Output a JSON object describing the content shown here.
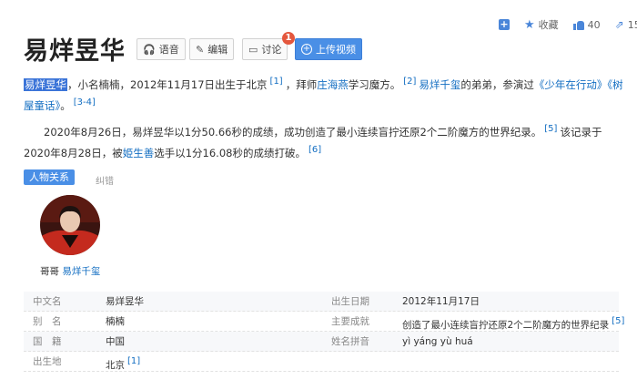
{
  "toolbar": {
    "add_icon": "plus-square-icon",
    "favorite_label": "收藏",
    "like_count": "40",
    "share_count": "15"
  },
  "header": {
    "title": "易烊昱华",
    "buttons": {
      "voice": "语音",
      "edit": "编辑",
      "discuss": "讨论",
      "upload": "上传视频"
    },
    "discuss_badge": "1"
  },
  "intro": {
    "name_highlight": "易烊昱华",
    "t1": "，小名楠楠，2012年11月17日出生于北京",
    "ref1": "[1]",
    "t2": "，拜师",
    "teacher": "庄海燕",
    "t3": "学习魔方。",
    "ref2": "[2]",
    "brother": "易烊千玺",
    "t4": "的弟弟，参演过",
    "show1": "《少年在行动》",
    "show2": "《树屋童话》",
    "t5": "。",
    "ref3": "[3-4]"
  },
  "record": {
    "t1": "2020年8月26日，易烊昱华以1分50.66秒的成绩，成功创造了最小连续盲拧还原2个二阶魔方的世界纪录。",
    "ref5": "[5]",
    "t2": "该记录于",
    "t3": "2020年8月28日，被",
    "breaker": "姫生善",
    "t4": "选手以1分16.08秒的成绩打破。",
    "ref6": "[6]"
  },
  "relations": {
    "tag": "人物关系",
    "report": "纠错",
    "relation_label": "哥哥",
    "relation_name": "易烊千玺"
  },
  "info": {
    "rows": [
      {
        "k1": "中文名",
        "v1": "易烊昱华",
        "k2": "出生日期",
        "v2": "2012年11月17日"
      },
      {
        "k1": "别　名",
        "v1": "楠楠",
        "k2": "主要成就",
        "v2": "创造了最小连续盲拧还原2个二阶魔方的世界纪录",
        "v2_ref": "[5]"
      },
      {
        "k1": "国　籍",
        "v1": "中国",
        "k2": "姓名拼音",
        "v2": "yì yáng yù huá"
      },
      {
        "k1": "出生地",
        "v1": "北京",
        "v1_ref": "[1]"
      }
    ]
  }
}
